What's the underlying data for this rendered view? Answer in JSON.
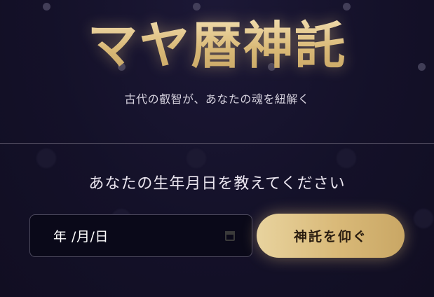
{
  "header": {
    "title": "マヤ暦神託",
    "subtitle": "古代の叡智が、あなたの魂を紐解く"
  },
  "form": {
    "prompt": "あなたの生年月日を教えてください",
    "date_field": {
      "value": "年 /月/日",
      "icon": "calendar-icon"
    },
    "submit_label": "神託を仰ぐ"
  },
  "colors": {
    "background": "#131026",
    "accent_gold": "#d9b977",
    "divider": "#5a5568",
    "text_light": "#ebe6f0",
    "input_bg": "#0a0919"
  }
}
